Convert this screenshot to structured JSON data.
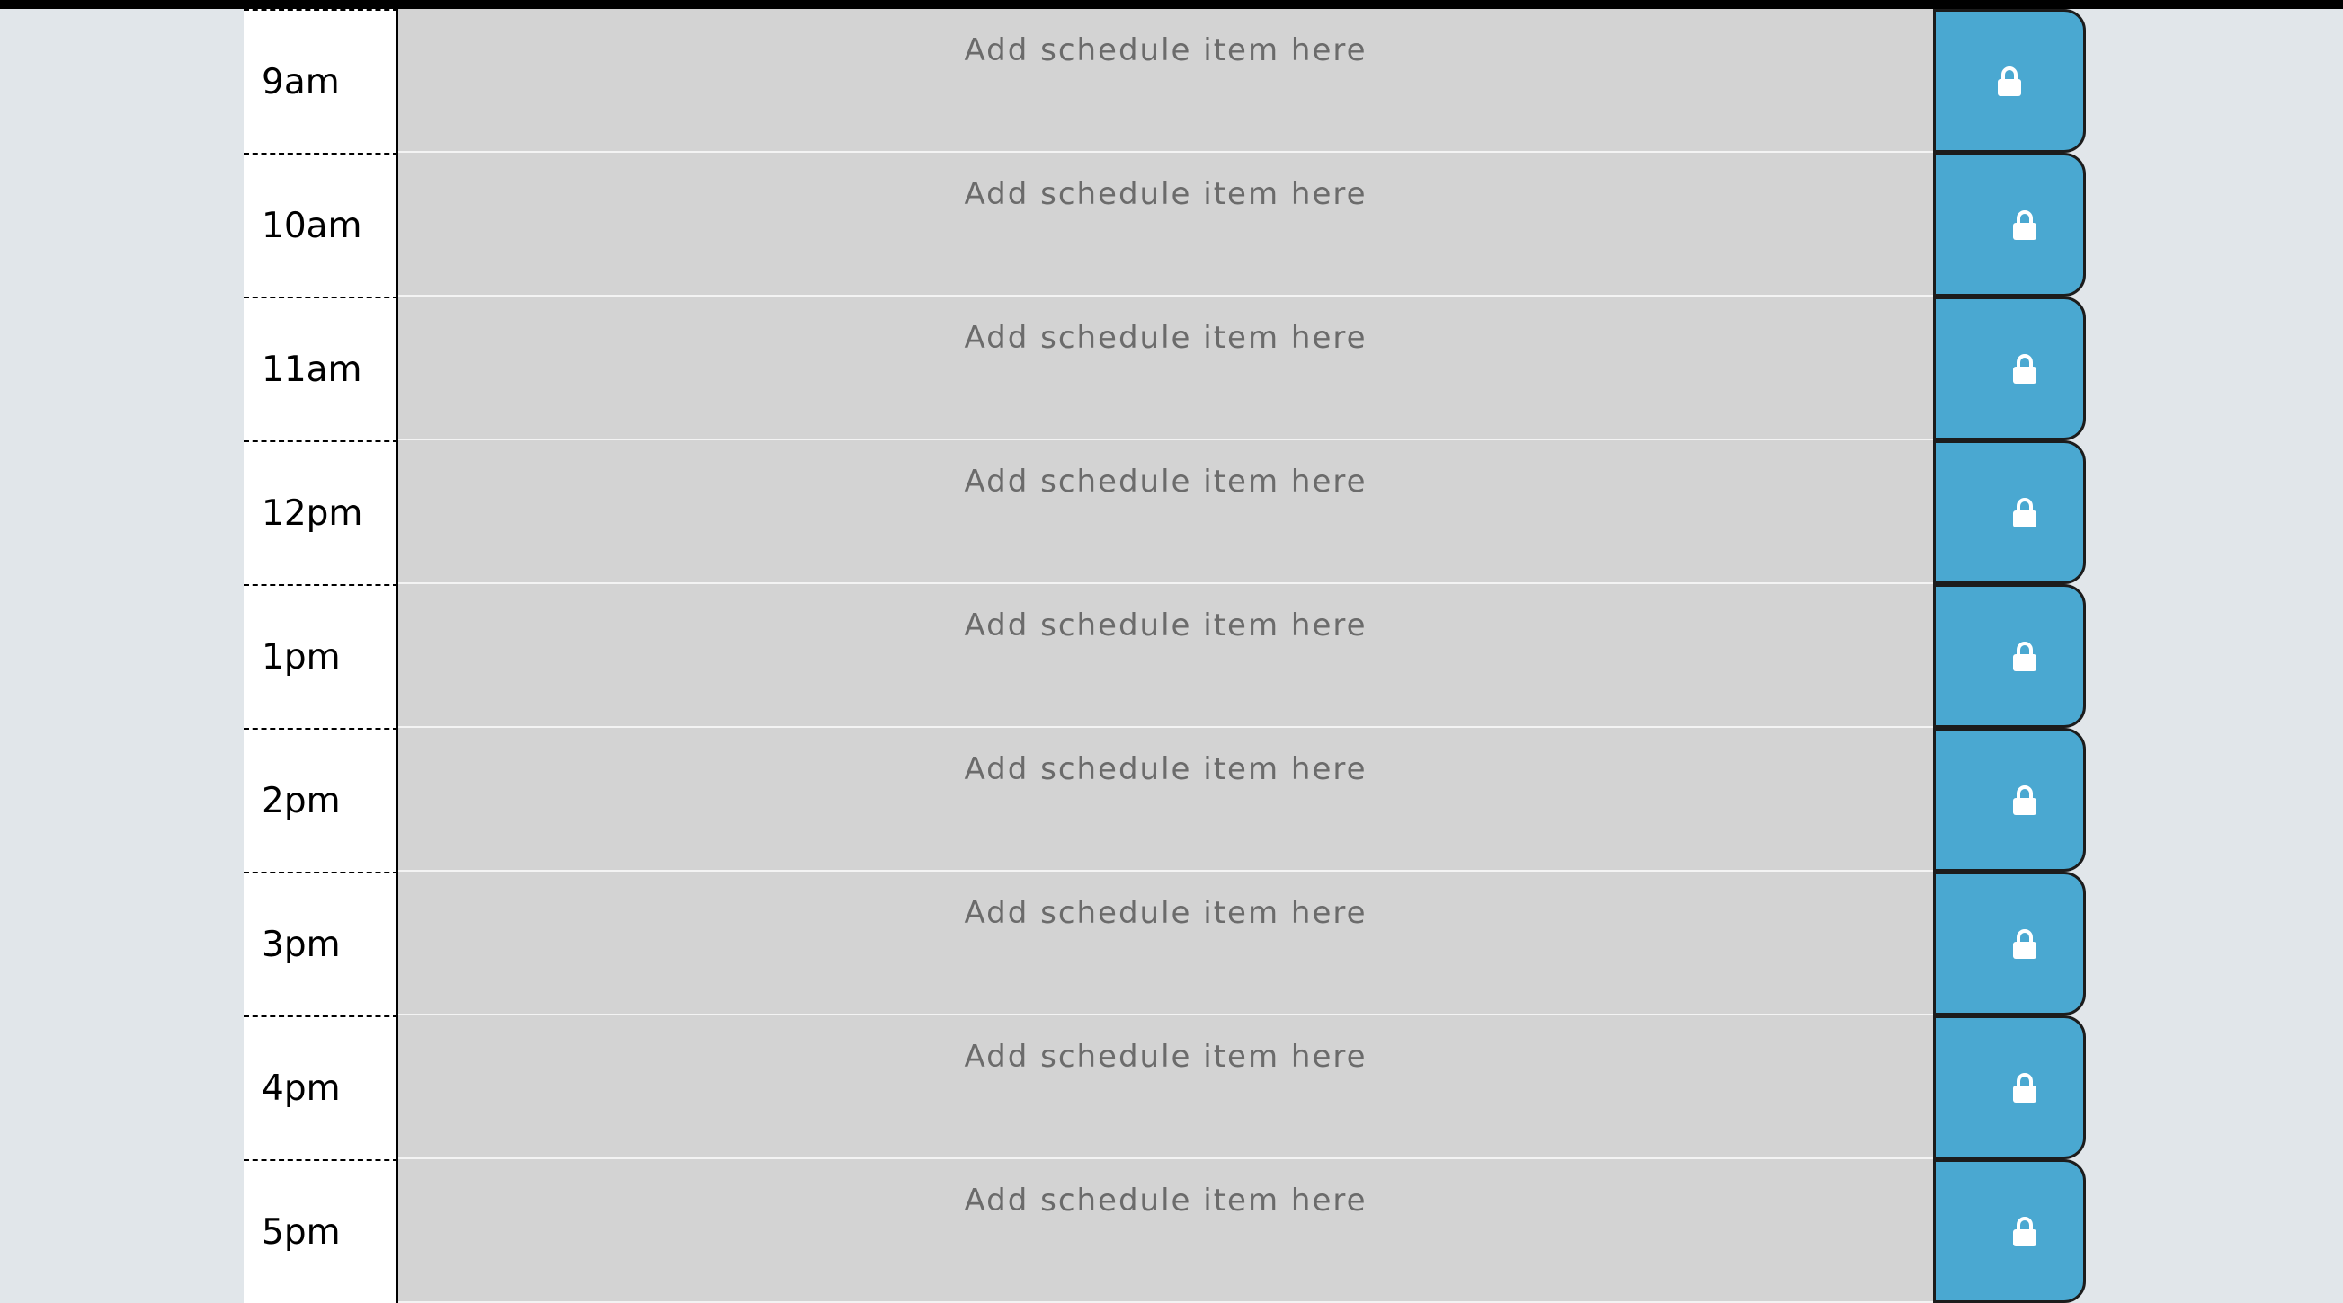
{
  "placeholder": "Add schedule item here",
  "rows": [
    {
      "hour": "9am"
    },
    {
      "hour": "10am"
    },
    {
      "hour": "11am"
    },
    {
      "hour": "12pm"
    },
    {
      "hour": "1pm"
    },
    {
      "hour": "2pm"
    },
    {
      "hour": "3pm"
    },
    {
      "hour": "4pm"
    },
    {
      "hour": "5pm"
    }
  ],
  "save_icon": "lock-icon",
  "colors": {
    "page_background": "#e1e6ea",
    "hour_background": "#ffffff",
    "description_background": "#d3d3d3",
    "save_button": "#4aa8d1",
    "placeholder_text": "#6b6b6b"
  }
}
